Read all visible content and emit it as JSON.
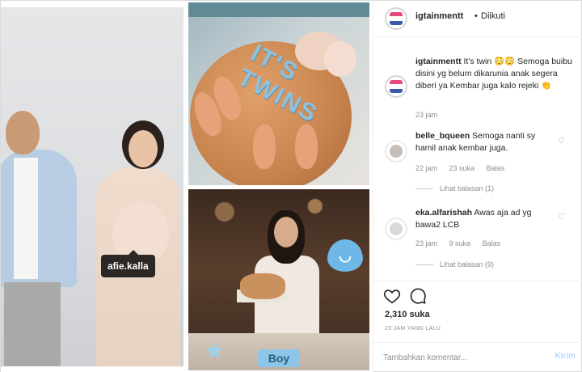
{
  "image": {
    "tag_label": "afie.kalla",
    "cake_text": "IT'S TWINS",
    "party_sign": "Boy"
  },
  "header": {
    "username": "igtainmentt",
    "separator": "•",
    "follow_status": "Diikuti"
  },
  "caption": {
    "username": "igtainmentt",
    "text": "It's twin 😳😳 Semoga buibu disini yg belum dikarunia anak segera diberi ya Kembar juga kalo rejeki 👏",
    "time": "23 jam"
  },
  "comments": [
    {
      "username": "belle_bqueen",
      "text": "Semoga nanti sy hamil anak kembar juga.",
      "time": "22 jam",
      "likes": "23 suka",
      "reply": "Balas",
      "view_replies": "Lihat balasan (1)"
    },
    {
      "username": "eka.alfarishah",
      "text": "Awas aja ad yg bawa2 LCB",
      "time": "23 jam",
      "likes": "9 suka",
      "reply": "Balas",
      "view_replies": "Lihat balasan (9)"
    }
  ],
  "actions": {
    "like_count": "2,310 suka",
    "time_ago": "23 JAM YANG LALU"
  },
  "comment_box": {
    "placeholder": "Tambahkan komentar...",
    "post_label": "Kirim"
  },
  "colors": {
    "link_blue": "#b3dbff",
    "muted": "#8e8e8e",
    "text": "#262626"
  }
}
